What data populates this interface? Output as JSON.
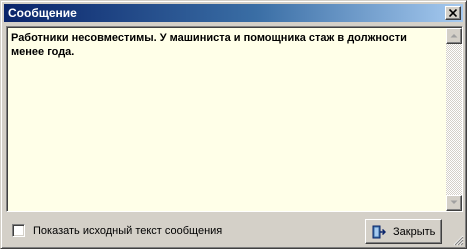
{
  "window": {
    "title": "Сообщение"
  },
  "message": {
    "text": "Работники несовместимы. У машиниста и помощника стаж в должности менее года."
  },
  "footer": {
    "show_source_label": "Показать исходный текст сообщения",
    "show_source_checked": false,
    "close_button_label": "Закрыть"
  },
  "colors": {
    "titlebar_start": "#0a246a",
    "titlebar_end": "#a6caf0",
    "message_background": "#ffffe8",
    "dialog_background": "#d4d0c8"
  },
  "icons": {
    "title_close": "close-icon",
    "button": "exit-door-icon",
    "scroll_up": "arrow-up-icon",
    "scroll_down": "arrow-down-icon"
  }
}
